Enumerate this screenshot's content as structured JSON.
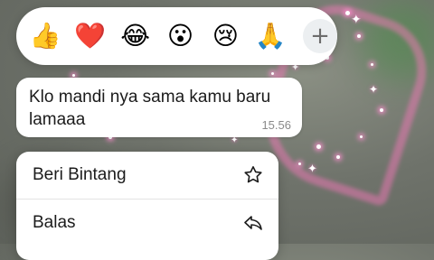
{
  "reactions": [
    {
      "emoji": "👍",
      "name": "thumbs-up"
    },
    {
      "emoji": "❤️",
      "name": "heart"
    },
    {
      "emoji": "😂",
      "name": "laughing"
    },
    {
      "emoji": "😮",
      "name": "surprised"
    },
    {
      "emoji": "😢",
      "name": "crying"
    },
    {
      "emoji": "🙏",
      "name": "praying-hands"
    }
  ],
  "reaction_more": "+",
  "message": {
    "text": "Klo mandi nya sama kamu baru lamaaa",
    "time": "15.56"
  },
  "menu": {
    "star_label": "Beri Bintang",
    "reply_label": "Balas"
  },
  "colors": {
    "bubble": "#ffffff",
    "background": "#6f736b",
    "sparkle": "#ff8fd0"
  }
}
